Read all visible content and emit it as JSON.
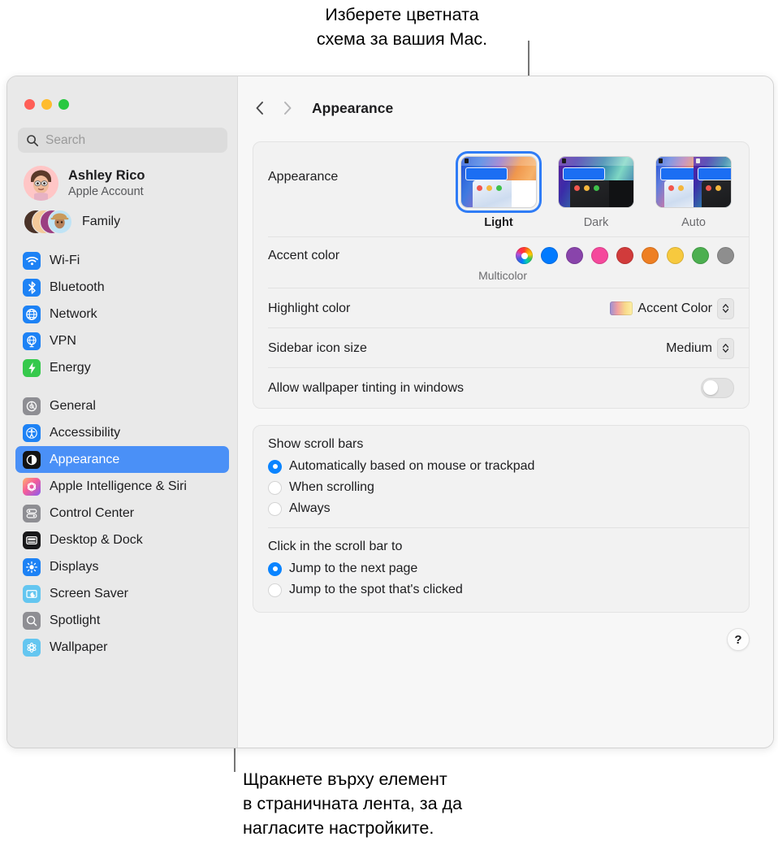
{
  "callouts": {
    "top": "Изберете цветната\nсхема за вашия Mac.",
    "bottom": "Щракнете върху елемент\nв страничната лента, за да\nнагласите настройките."
  },
  "window": {
    "traffic_lights": [
      "close-red",
      "minimize-yellow",
      "zoom-green"
    ],
    "title": "Appearance"
  },
  "search": {
    "placeholder": "Search",
    "value": "",
    "icon": "search-icon"
  },
  "account": {
    "name": "Ashley Rico",
    "subtitle": "Apple Account",
    "avatar": "memoji-avatar"
  },
  "family": {
    "label": "Family",
    "avatar_count": 4
  },
  "sidebar": {
    "groups": [
      {
        "items": [
          {
            "label": "Wi-Fi",
            "icon": "wifi-icon",
            "color": "#1d82f5",
            "selected": false
          },
          {
            "label": "Bluetooth",
            "icon": "bluetooth-icon",
            "color": "#1d82f5",
            "selected": false
          },
          {
            "label": "Network",
            "icon": "globe-icon",
            "color": "#1d82f5",
            "selected": false
          },
          {
            "label": "VPN",
            "icon": "vpn-globe-icon",
            "color": "#1d82f5",
            "selected": false
          },
          {
            "label": "Energy",
            "icon": "bolt-icon",
            "color": "#36c94c",
            "selected": false
          }
        ]
      },
      {
        "items": [
          {
            "label": "General",
            "icon": "gear-icon",
            "color": "#8e8e93",
            "selected": false
          },
          {
            "label": "Accessibility",
            "icon": "accessibility-icon",
            "color": "#1d82f5",
            "selected": false
          },
          {
            "label": "Appearance",
            "icon": "appearance-icon",
            "color": "#000000",
            "selected": true
          },
          {
            "label": "Apple Intelligence & Siri",
            "icon": "siri-icon",
            "color": "#f45c9a",
            "selected": false
          },
          {
            "label": "Control Center",
            "icon": "control-center-icon",
            "color": "#8e8e93",
            "selected": false
          },
          {
            "label": "Desktop & Dock",
            "icon": "desktop-dock-icon",
            "color": "#1c1c1e",
            "selected": false
          },
          {
            "label": "Displays",
            "icon": "brightness-icon",
            "color": "#1d82f5",
            "selected": false
          },
          {
            "label": "Screen Saver",
            "icon": "screen-saver-icon",
            "color": "#64c6f0",
            "selected": false
          },
          {
            "label": "Spotlight",
            "icon": "spotlight-icon",
            "color": "#8e8e93",
            "selected": false
          },
          {
            "label": "Wallpaper",
            "icon": "wallpaper-icon",
            "color": "#64c6f0",
            "selected": false
          }
        ]
      }
    ]
  },
  "toolbar": {
    "back_icon": "chevron-left-icon",
    "forward_icon": "chevron-right-icon"
  },
  "appearance_section": {
    "label": "Appearance",
    "themes": [
      {
        "name": "Light",
        "selected": true
      },
      {
        "name": "Dark",
        "selected": false
      },
      {
        "name": "Auto",
        "selected": false
      }
    ],
    "accent": {
      "label": "Accent color",
      "caption": "Multicolor",
      "swatches": [
        {
          "name": "Multicolor",
          "color": "multicolor",
          "selected": true
        },
        {
          "name": "Blue",
          "color": "#007aff",
          "selected": false
        },
        {
          "name": "Purple",
          "color": "#8944ab",
          "selected": false
        },
        {
          "name": "Pink",
          "color": "#f5499c",
          "selected": false
        },
        {
          "name": "Red",
          "color": "#d13b3b",
          "selected": false
        },
        {
          "name": "Orange",
          "color": "#ee7f23",
          "selected": false
        },
        {
          "name": "Yellow",
          "color": "#f7c93e",
          "selected": false
        },
        {
          "name": "Green",
          "color": "#4caf50",
          "selected": false
        },
        {
          "name": "Graphite",
          "color": "#8e8e8e",
          "selected": false
        }
      ]
    },
    "highlight": {
      "label": "Highlight color",
      "value": "Accent Color",
      "swatch": "gradient"
    },
    "sidebar_icon_size": {
      "label": "Sidebar icon size",
      "value": "Medium"
    },
    "wallpaper_tinting": {
      "label": "Allow wallpaper tinting in windows",
      "enabled": false
    }
  },
  "scroll_section": {
    "show_scroll_bars": {
      "title": "Show scroll bars",
      "options": [
        {
          "label": "Automatically based on mouse or trackpad",
          "selected": true
        },
        {
          "label": "When scrolling",
          "selected": false
        },
        {
          "label": "Always",
          "selected": false
        }
      ]
    },
    "click_scroll_bar": {
      "title": "Click in the scroll bar to",
      "options": [
        {
          "label": "Jump to the next page",
          "selected": true
        },
        {
          "label": "Jump to the spot that's clicked",
          "selected": false
        }
      ]
    }
  },
  "help": {
    "label": "?",
    "icon": "question-mark-icon"
  }
}
